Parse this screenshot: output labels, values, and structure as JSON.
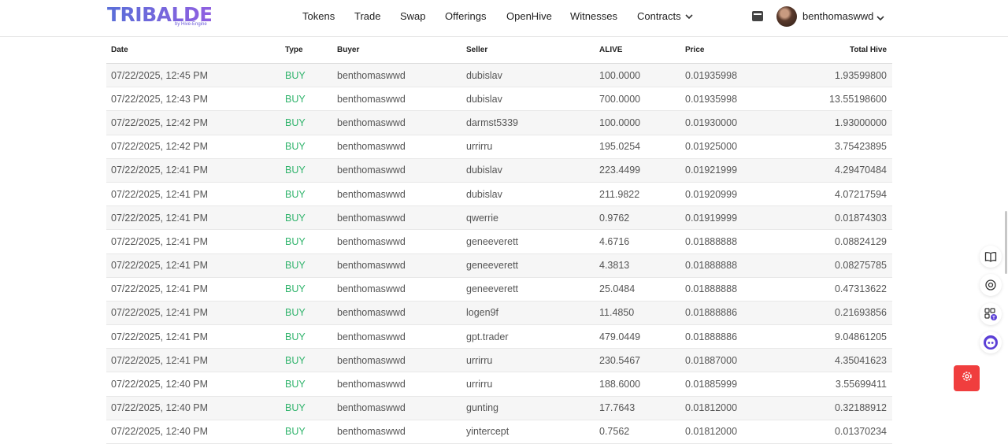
{
  "header": {
    "logo_text": "TRIBALDEX",
    "logo_sub": "by Hive-Engine",
    "nav": [
      "Tokens",
      "Trade",
      "Swap",
      "Offerings",
      "OpenHive",
      "Witnesses",
      "Contracts"
    ],
    "username": "benthomaswwd"
  },
  "table": {
    "columns": [
      "Date",
      "Type",
      "Buyer",
      "Seller",
      "ALIVE",
      "Price",
      "Total Hive"
    ],
    "rows": [
      [
        "07/22/2025, 12:45 PM",
        "BUY",
        "benthomaswwd",
        "dubislav",
        "100.0000",
        "0.01935998",
        "1.93599800"
      ],
      [
        "07/22/2025, 12:43 PM",
        "BUY",
        "benthomaswwd",
        "dubislav",
        "700.0000",
        "0.01935998",
        "13.55198600"
      ],
      [
        "07/22/2025, 12:42 PM",
        "BUY",
        "benthomaswwd",
        "darmst5339",
        "100.0000",
        "0.01930000",
        "1.93000000"
      ],
      [
        "07/22/2025, 12:42 PM",
        "BUY",
        "benthomaswwd",
        "urrirru",
        "195.0254",
        "0.01925000",
        "3.75423895"
      ],
      [
        "07/22/2025, 12:41 PM",
        "BUY",
        "benthomaswwd",
        "dubislav",
        "223.4499",
        "0.01921999",
        "4.29470484"
      ],
      [
        "07/22/2025, 12:41 PM",
        "BUY",
        "benthomaswwd",
        "dubislav",
        "211.9822",
        "0.01920999",
        "4.07217594"
      ],
      [
        "07/22/2025, 12:41 PM",
        "BUY",
        "benthomaswwd",
        "qwerrie",
        "0.9762",
        "0.01919999",
        "0.01874303"
      ],
      [
        "07/22/2025, 12:41 PM",
        "BUY",
        "benthomaswwd",
        "geneeverett",
        "4.6716",
        "0.01888888",
        "0.08824129"
      ],
      [
        "07/22/2025, 12:41 PM",
        "BUY",
        "benthomaswwd",
        "geneeverett",
        "4.3813",
        "0.01888888",
        "0.08275785"
      ],
      [
        "07/22/2025, 12:41 PM",
        "BUY",
        "benthomaswwd",
        "geneeverett",
        "25.0484",
        "0.01888888",
        "0.47313622"
      ],
      [
        "07/22/2025, 12:41 PM",
        "BUY",
        "benthomaswwd",
        "logen9f",
        "11.4850",
        "0.01888886",
        "0.21693856"
      ],
      [
        "07/22/2025, 12:41 PM",
        "BUY",
        "benthomaswwd",
        "gpt.trader",
        "479.0449",
        "0.01888886",
        "9.04861205"
      ],
      [
        "07/22/2025, 12:41 PM",
        "BUY",
        "benthomaswwd",
        "urrirru",
        "230.5467",
        "0.01887000",
        "4.35041623"
      ],
      [
        "07/22/2025, 12:40 PM",
        "BUY",
        "benthomaswwd",
        "urrirru",
        "188.6000",
        "0.01885999",
        "3.55699411"
      ],
      [
        "07/22/2025, 12:40 PM",
        "BUY",
        "benthomaswwd",
        "gunting",
        "17.7643",
        "0.01812000",
        "0.32188912"
      ],
      [
        "07/22/2025, 12:40 PM",
        "BUY",
        "benthomaswwd",
        "yintercept",
        "0.7562",
        "0.01812000",
        "0.01370234"
      ]
    ]
  },
  "side_icons": [
    "book-icon",
    "help-icon",
    "apps-icon",
    "chat-bot-icon"
  ],
  "settings_icon": "gear-icon",
  "colors": {
    "buy": "#2fb36b",
    "accent": "#f03e3e",
    "logo": "#5a6fd8"
  }
}
